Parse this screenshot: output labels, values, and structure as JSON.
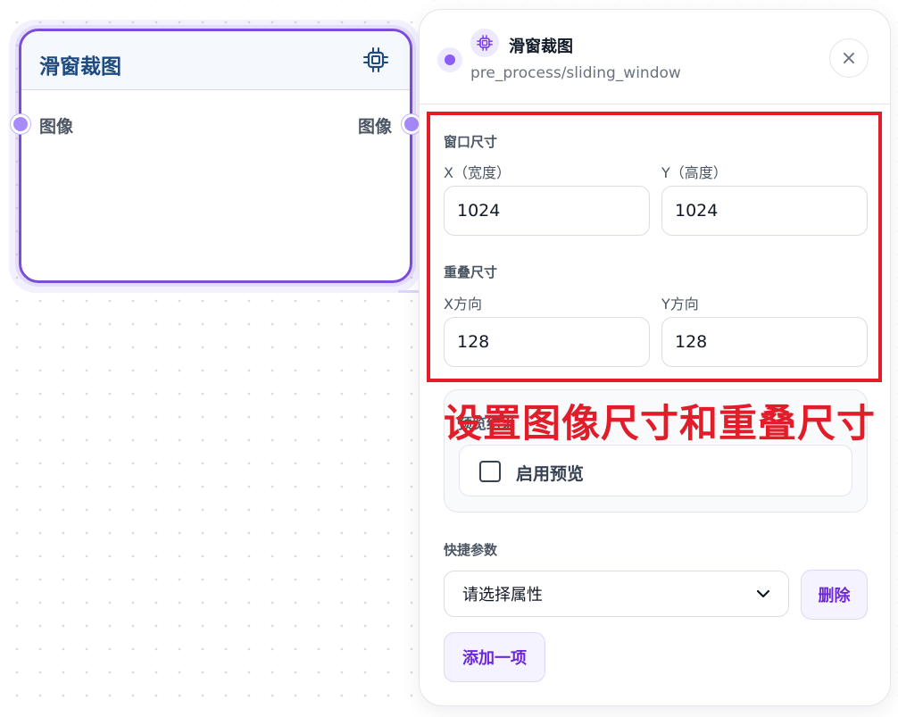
{
  "node": {
    "title": "滑窗裁图",
    "icon": "chip-icon",
    "input_port_label": "图像",
    "output_port_label": "图像"
  },
  "panel": {
    "title": "滑窗裁图",
    "path": "pre_process/sliding_window",
    "close_label": "×",
    "window_size": {
      "section_label": "窗口尺寸",
      "x_label": "X（宽度）",
      "x_value": "1024",
      "y_label": "Y（高度）",
      "y_value": "1024"
    },
    "overlap_size": {
      "section_label": "重叠尺寸",
      "x_label": "X方向",
      "x_value": "128",
      "y_label": "Y方向",
      "y_value": "128"
    },
    "preview": {
      "section_label": "预览结果",
      "checkbox_label": "启用预览",
      "checked": false
    },
    "quick_params": {
      "section_label": "快捷参数",
      "select_placeholder": "请选择属性",
      "delete_label": "删除",
      "add_label": "添加一项"
    }
  },
  "annotation": {
    "text": "设置图像尺寸和重叠尺寸",
    "color": "#e11d2a"
  },
  "colors": {
    "accent": "#7c4ddc",
    "port": "#a78bfa",
    "node_title": "#1e4a80"
  }
}
